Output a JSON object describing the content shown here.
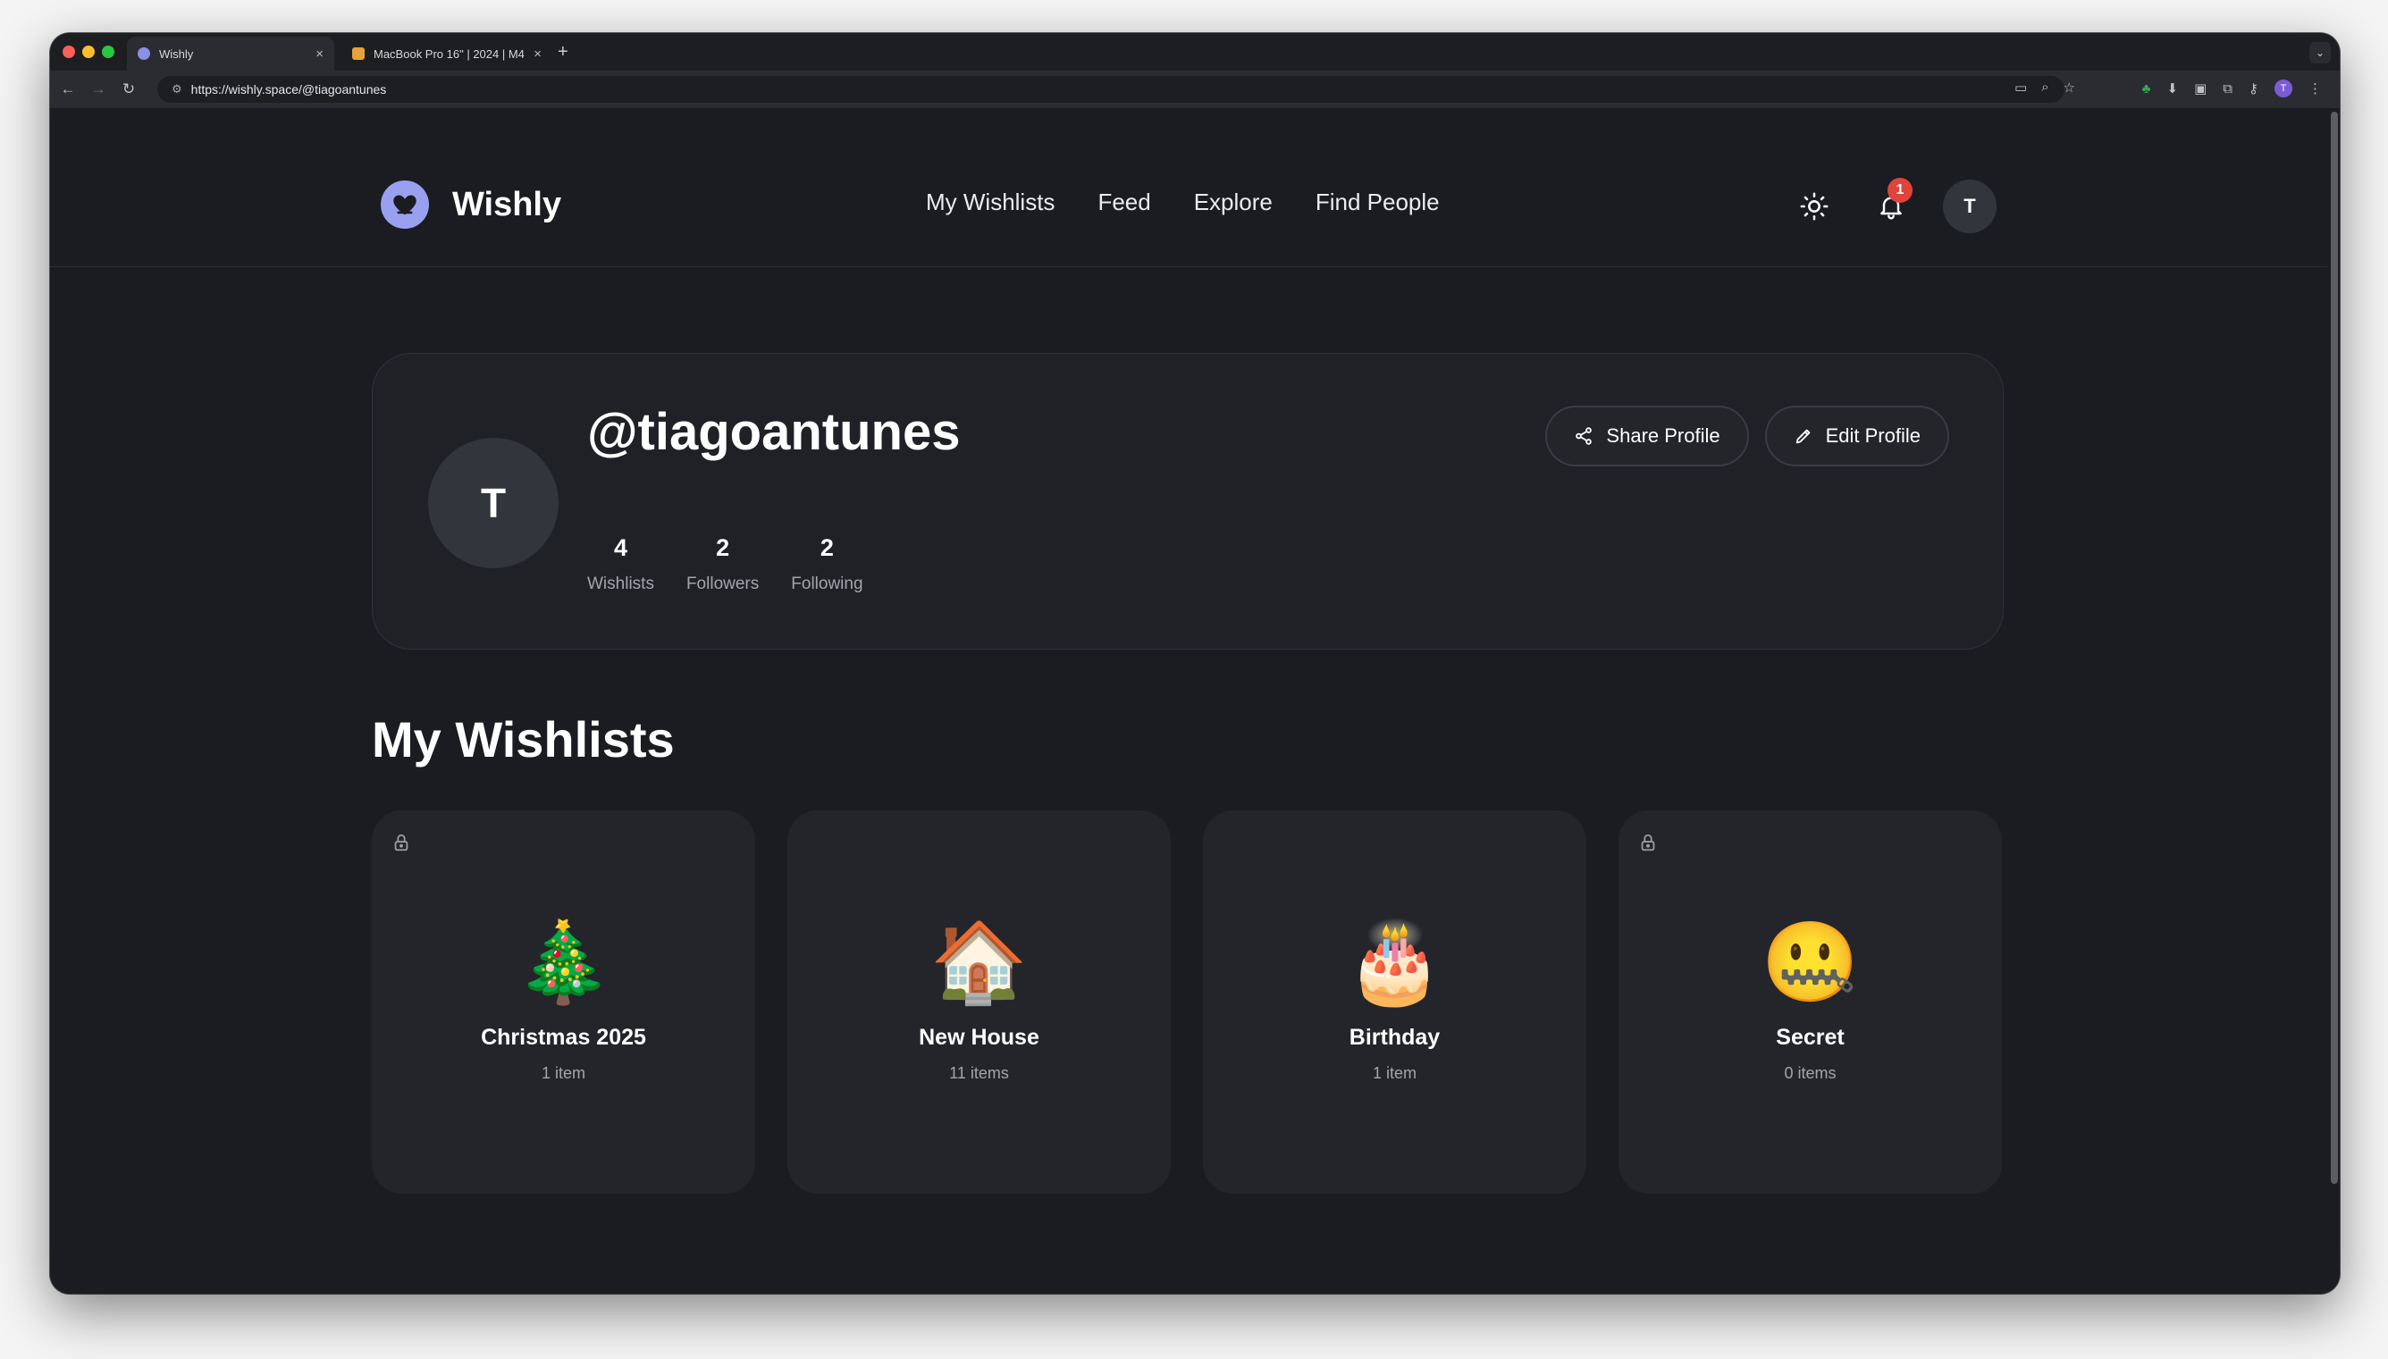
{
  "browser": {
    "tabs": [
      {
        "title": "Wishly",
        "active": true
      },
      {
        "title": "MacBook Pro 16\" | 2024 | M4",
        "active": false
      }
    ],
    "url": "https://wishly.space/@tiagoantunes",
    "profile_initial": "T"
  },
  "header": {
    "logo_text": "Wishly",
    "nav": [
      "My Wishlists",
      "Feed",
      "Explore",
      "Find People"
    ],
    "notification_count": "1",
    "avatar_initial": "T"
  },
  "profile": {
    "avatar_initial": "T",
    "username": "@tiagoantunes",
    "stats": [
      {
        "value": "4",
        "label": "Wishlists"
      },
      {
        "value": "2",
        "label": "Followers"
      },
      {
        "value": "2",
        "label": "Following"
      }
    ],
    "share_label": "Share Profile",
    "edit_label": "Edit Profile"
  },
  "wishlists": {
    "title": "My Wishlists",
    "items": [
      {
        "emoji": "🎄",
        "name": "Christmas 2025",
        "count": "1 item",
        "locked": true
      },
      {
        "emoji": "🏠",
        "name": "New House",
        "count": "11 items",
        "locked": false
      },
      {
        "emoji": "🎂",
        "name": "Birthday",
        "count": "1 item",
        "locked": false
      },
      {
        "emoji": "🤐",
        "name": "Secret",
        "count": "0 items",
        "locked": true
      }
    ]
  },
  "colors": {
    "page_bg": "#1a1c22",
    "card_bg": "#23252b",
    "accent": "#9aa0f0",
    "badge": "#e0443a"
  }
}
